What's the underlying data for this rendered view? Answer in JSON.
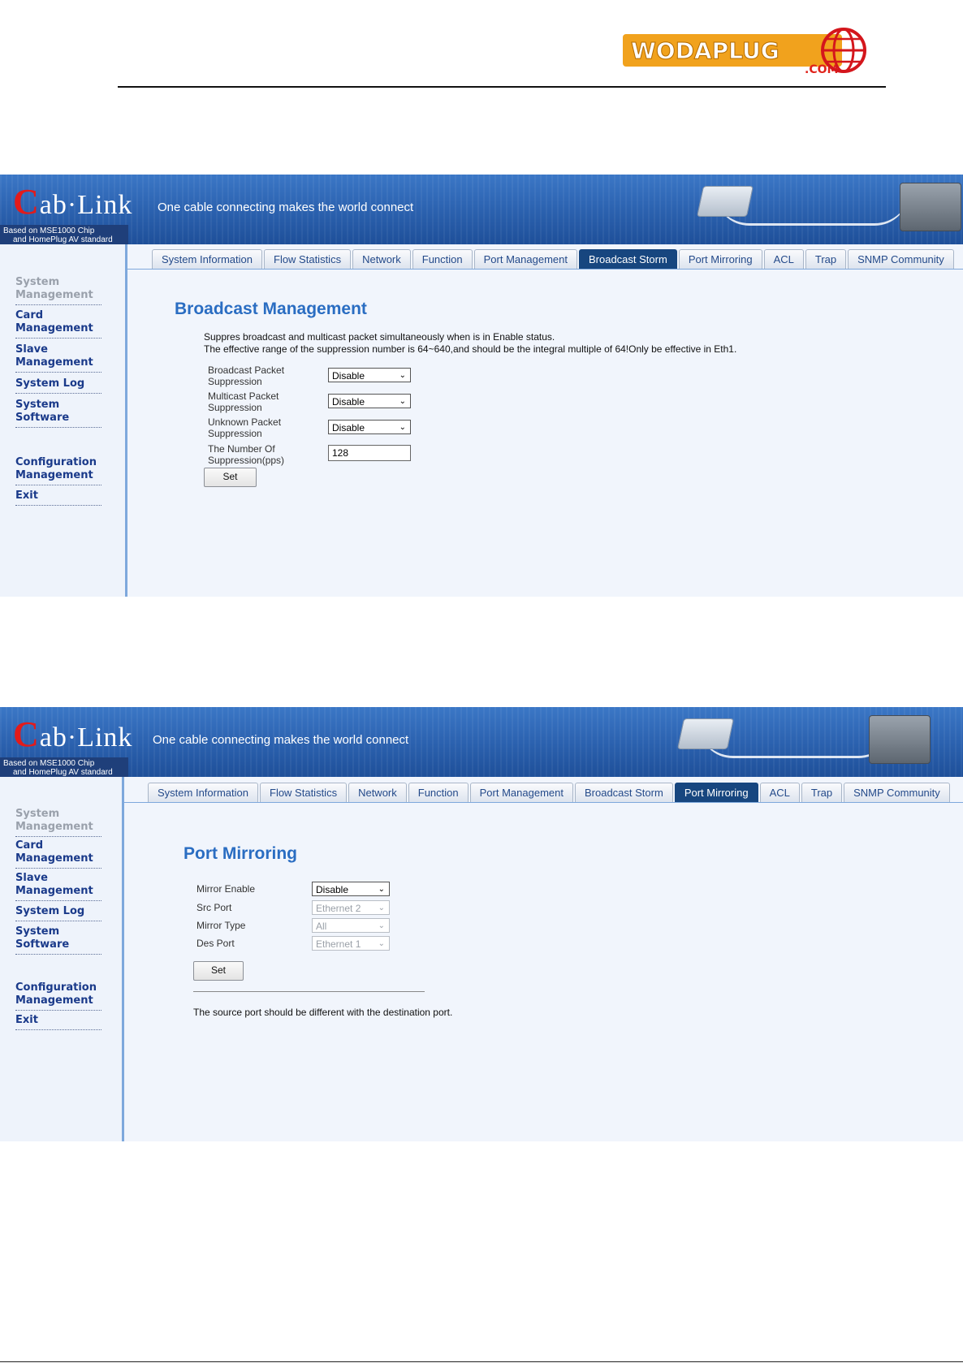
{
  "page": {
    "logo": {
      "text": "WODAPLUG",
      "sub": ".COM"
    }
  },
  "shots": [
    {
      "banner": {
        "brand_c": "C",
        "brand_rest": "ab·Link",
        "slogan": "One cable connecting makes the world connect",
        "chip_line1": "Based on MSE1000 Chip",
        "chip_line2": "and HomePlug AV standard"
      },
      "sidebar": {
        "system_management": "System Management",
        "card_management": "Card Management",
        "slave_management": "Slave Management",
        "system_log": "System Log",
        "system_software": "System Software",
        "configuration_management": "Configuration Management",
        "exit": "Exit"
      },
      "tabs": [
        "System Information",
        "Flow Statistics",
        "Network",
        "Function",
        "Port Management",
        "Broadcast Storm",
        "Port Mirroring",
        "ACL",
        "Trap",
        "SNMP Community"
      ],
      "active_tab": "Broadcast Storm",
      "title": "Broadcast Management",
      "desc1": "Suppres broadcast and multicast packet simultaneously when is in Enable status.",
      "desc2": "The effective range of the suppression number is 64~640,and should be the integral multiple of 64!Only be effective in Eth1.",
      "fields": {
        "broadcast_label_1": "Broadcast Packet",
        "broadcast_label_2": "Suppression",
        "broadcast_value": "Disable",
        "multicast_label_1": "Multicast Packet",
        "multicast_label_2": "Suppression",
        "multicast_value": "Disable",
        "unknown_label_1": "Unknown Packet",
        "unknown_label_2": "Suppression",
        "unknown_value": "Disable",
        "number_label_1": "The Number Of",
        "number_label_2": "Suppression(pps)",
        "number_value": "128"
      },
      "set_label": "Set"
    },
    {
      "banner": {
        "brand_c": "C",
        "brand_rest": "ab·Link",
        "slogan": "One cable connecting makes the world connect",
        "chip_line1": "Based on MSE1000 Chip",
        "chip_line2": "and HomePlug AV standard"
      },
      "sidebar": {
        "system_management": "System Management",
        "card_management": "Card Management",
        "slave_management": "Slave Management",
        "system_log": "System Log",
        "system_software": "System Software",
        "configuration_management": "Configuration Management",
        "exit": "Exit"
      },
      "tabs": [
        "System Information",
        "Flow Statistics",
        "Network",
        "Function",
        "Port Management",
        "Broadcast Storm",
        "Port Mirroring",
        "ACL",
        "Trap",
        "SNMP Community"
      ],
      "active_tab": "Port Mirroring",
      "title": "Port Mirroring",
      "fields": {
        "mirror_enable_label": "Mirror Enable",
        "mirror_enable_value": "Disable",
        "src_port_label": "Src Port",
        "src_port_value": "Ethernet 2",
        "mirror_type_label": "Mirror Type",
        "mirror_type_value": "All",
        "des_port_label": "Des Port",
        "des_port_value": "Ethernet 1"
      },
      "set_label": "Set",
      "note": "The source port should be different with the destination port."
    }
  ],
  "colors": {
    "accent": "#2a6dc2",
    "active_tab": "#17467f",
    "sidebar_link": "#1a3a8a"
  }
}
